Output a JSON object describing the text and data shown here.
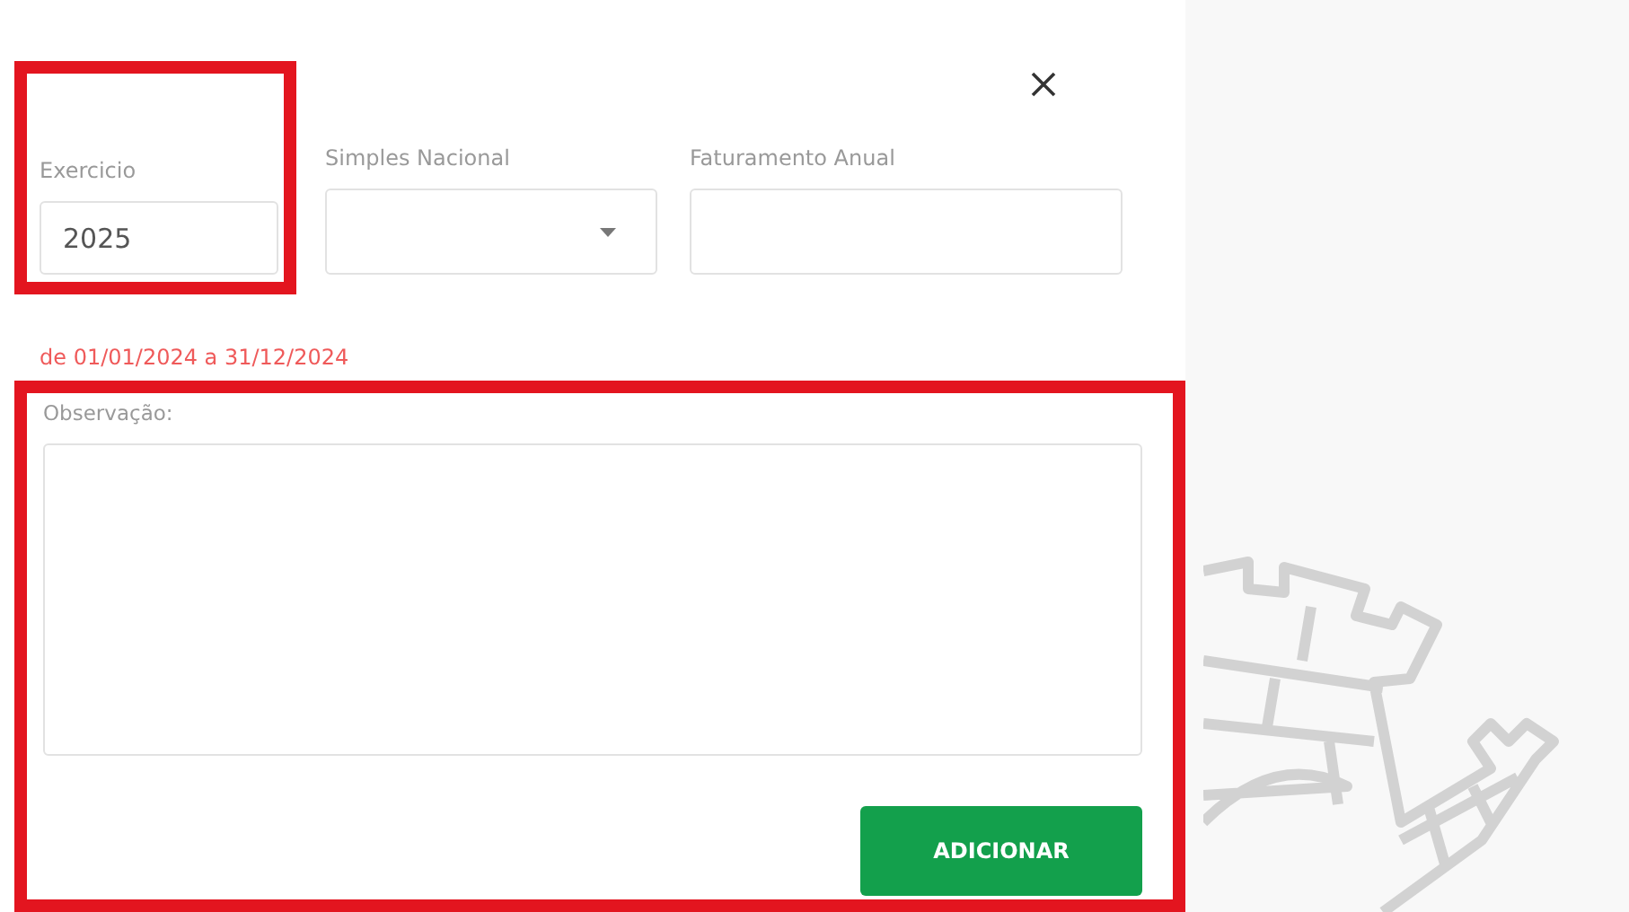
{
  "fields": [
    {
      "kind": "text",
      "label": "Exercicio",
      "value": "2025",
      "highlighted": true
    },
    {
      "kind": "select",
      "label": "Simples Nacional",
      "highlighted": false
    },
    {
      "kind": "text",
      "label": "Faturamento Anual",
      "highlighted": false
    }
  ],
  "period_note": "de 01/01/2024 a 31/12/2024",
  "observation": {
    "label": "Observação:",
    "highlighted": true
  },
  "add_button": {
    "label": "ADICIONAR"
  }
}
